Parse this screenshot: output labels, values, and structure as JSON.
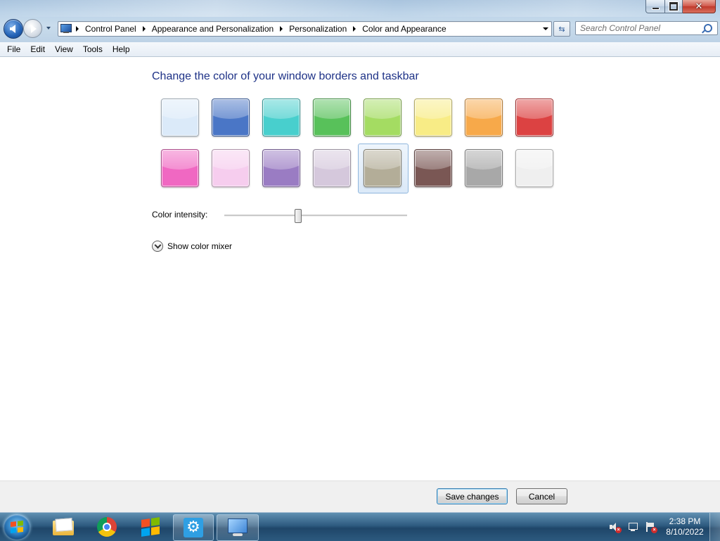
{
  "window": {
    "caption": {
      "close_glyph": "✕"
    },
    "address": {
      "breadcrumbs": [
        "Control Panel",
        "Appearance and Personalization",
        "Personalization",
        "Color and Appearance"
      ]
    },
    "search": {
      "placeholder": "Search Control Panel",
      "value": ""
    },
    "menu": [
      "File",
      "Edit",
      "View",
      "Tools",
      "Help"
    ]
  },
  "content": {
    "heading": "Change the color of your window borders and taskbar",
    "swatches": [
      {
        "name": "sky",
        "color": "#dbeaf9"
      },
      {
        "name": "twilight",
        "color": "#4a76c6"
      },
      {
        "name": "sea",
        "color": "#48cfcd"
      },
      {
        "name": "leaf",
        "color": "#58c15a"
      },
      {
        "name": "lime",
        "color": "#a4dc62"
      },
      {
        "name": "sun",
        "color": "#f8ec86"
      },
      {
        "name": "pumpkin",
        "color": "#f7a94a"
      },
      {
        "name": "ruby",
        "color": "#dc4242"
      },
      {
        "name": "fuchsia",
        "color": "#f068c2"
      },
      {
        "name": "blush",
        "color": "#f6cdee"
      },
      {
        "name": "violet",
        "color": "#9a7cc3"
      },
      {
        "name": "lavender",
        "color": "#d5c8dc"
      },
      {
        "name": "taupe",
        "color": "#b3ad98"
      },
      {
        "name": "chocolate",
        "color": "#7a5754"
      },
      {
        "name": "slate",
        "color": "#a8a8a8"
      },
      {
        "name": "frost",
        "color": "#efefef"
      }
    ],
    "selected_swatch": "taupe",
    "intensity": {
      "label": "Color intensity:",
      "value": 0.42
    },
    "mixer_label": "Show color mixer"
  },
  "footer": {
    "save_label": "Save changes",
    "cancel_label": "Cancel"
  },
  "taskbar": {
    "pinned": [
      "windows-explorer",
      "google-chrome",
      "windows-logo-app",
      "settings-app",
      "control-panel"
    ],
    "tray": {
      "time": "2:38 PM",
      "date": "8/10/2022"
    }
  },
  "colors": {
    "heading": "#1e3287",
    "taskbar": "#2e5b80",
    "selected_border": "#8fb6dd"
  }
}
